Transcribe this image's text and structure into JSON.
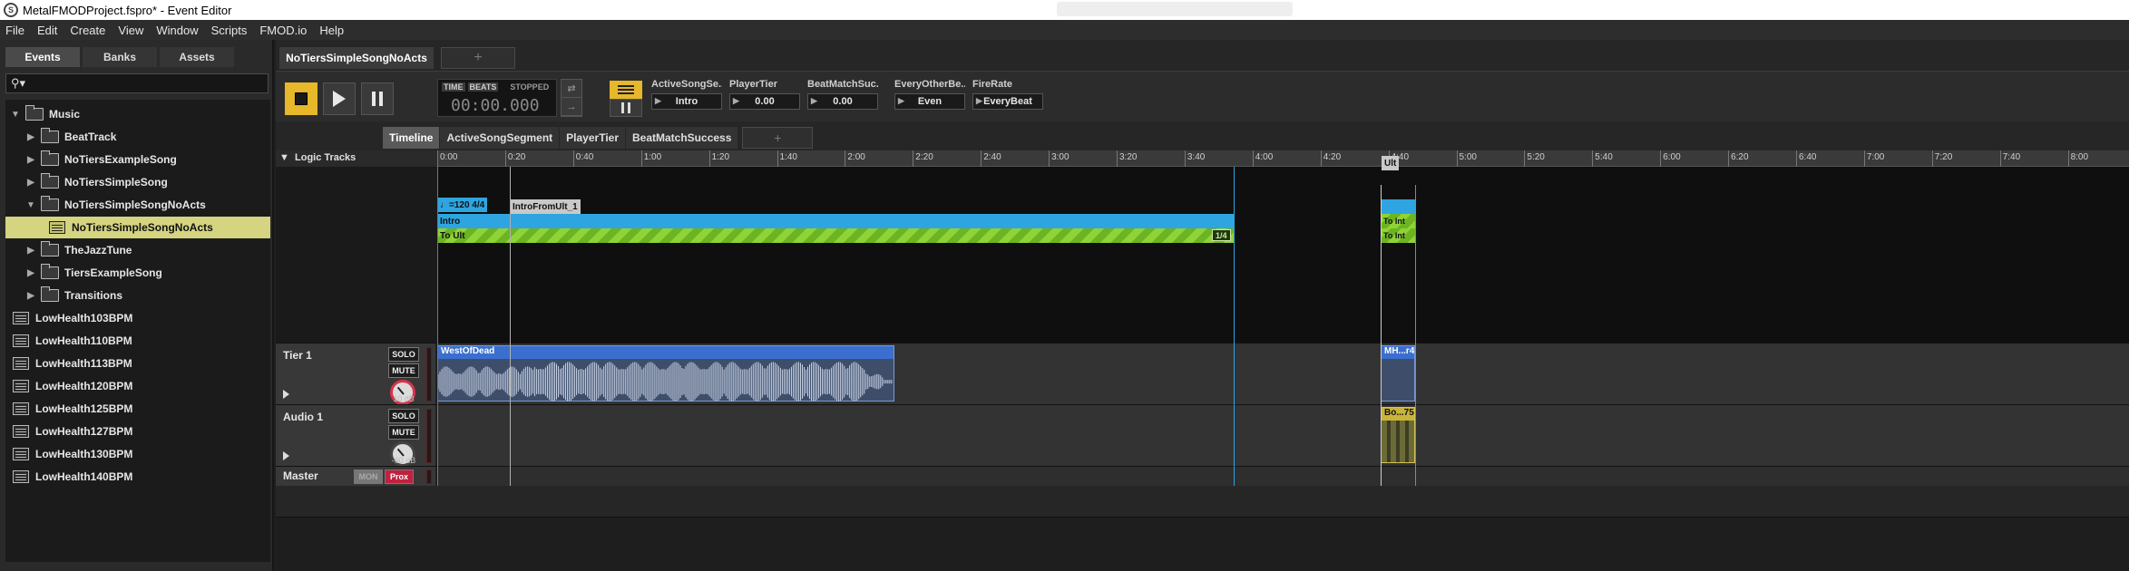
{
  "window": {
    "title": "MetalFMODProject.fspro* - Event Editor"
  },
  "menu": [
    "File",
    "Edit",
    "Create",
    "View",
    "Window",
    "Scripts",
    "FMOD.io",
    "Help"
  ],
  "browser": {
    "tabs": [
      "Events",
      "Banks",
      "Assets"
    ],
    "search_placeholder": "",
    "tree": [
      {
        "label": "Music",
        "type": "folder",
        "arrow": "▼",
        "level": 0
      },
      {
        "label": "BeatTrack",
        "type": "folder",
        "arrow": "▶",
        "level": 1
      },
      {
        "label": "NoTiersExampleSong",
        "type": "folder",
        "arrow": "▶",
        "level": 1
      },
      {
        "label": "NoTiersSimpleSong",
        "type": "folder",
        "arrow": "▶",
        "level": 1
      },
      {
        "label": "NoTiersSimpleSongNoActs",
        "type": "folder",
        "arrow": "▼",
        "level": 1
      },
      {
        "label": "NoTiersSimpleSongNoActs",
        "type": "event",
        "arrow": "",
        "level": 2,
        "selected": true
      },
      {
        "label": "TheJazzTune",
        "type": "folder",
        "arrow": "▶",
        "level": 1
      },
      {
        "label": "TiersExampleSong",
        "type": "folder",
        "arrow": "▶",
        "level": 1
      },
      {
        "label": "Transitions",
        "type": "folder",
        "arrow": "▶",
        "level": 1
      },
      {
        "label": "LowHealth103BPM",
        "type": "event",
        "arrow": "",
        "level": 0
      },
      {
        "label": "LowHealth110BPM",
        "type": "event",
        "arrow": "",
        "level": 0
      },
      {
        "label": "LowHealth113BPM",
        "type": "event",
        "arrow": "",
        "level": 0
      },
      {
        "label": "LowHealth120BPM",
        "type": "event",
        "arrow": "",
        "level": 0
      },
      {
        "label": "LowHealth125BPM",
        "type": "event",
        "arrow": "",
        "level": 0
      },
      {
        "label": "LowHealth127BPM",
        "type": "event",
        "arrow": "",
        "level": 0
      },
      {
        "label": "LowHealth130BPM",
        "type": "event",
        "arrow": "",
        "level": 0
      },
      {
        "label": "LowHealth140BPM",
        "type": "event",
        "arrow": "",
        "level": 0
      }
    ]
  },
  "editor": {
    "event_tab": "NoTiersSimpleSongNoActs",
    "add_tab": "+",
    "time": {
      "mode_time": "TIME",
      "mode_beats": "BEATS",
      "state": "STOPPED",
      "value": "00:00.000"
    },
    "parameters": [
      {
        "name": "ActiveSongSe...",
        "value": "Intro"
      },
      {
        "name": "PlayerTier",
        "value": "0.00"
      },
      {
        "name": "BeatMatchSuc...",
        "value": "0.00"
      },
      {
        "name": "EveryOtherBe...",
        "value": "Even"
      },
      {
        "name": "FireRate",
        "value": "EveryBeat"
      }
    ],
    "subtabs": [
      "Timeline",
      "ActiveSongSegment",
      "PlayerTier",
      "BeatMatchSuccess"
    ],
    "logic_tracks_label": "Logic Tracks",
    "ruler": [
      "0:00",
      "0:20",
      "0:40",
      "1:00",
      "1:20",
      "1:40",
      "2:00",
      "2:20",
      "2:40",
      "3:00",
      "3:20",
      "3:40",
      "4:00",
      "4:20",
      "4:40",
      "5:00",
      "5:20",
      "5:40",
      "6:00",
      "6:20",
      "6:40",
      "7:00",
      "7:20",
      "7:40",
      "8:00"
    ],
    "markers": {
      "tempo": "♩=120 4/4",
      "transition": "IntroFromUlt_1",
      "ult": "Ult",
      "intro_region": "Intro",
      "to_ult": "To Ult",
      "loop_badge": "1/4",
      "to_intro_1": "To Int",
      "to_intro_2": "To Int",
      "to_intro_badge": "1"
    },
    "tracks": [
      {
        "name": "Tier 1",
        "solo": "SOLO",
        "mute": "MUTE",
        "db": "10 dB",
        "clip": "WestOfDead",
        "clip2": "MH...r4"
      },
      {
        "name": "Audio 1",
        "solo": "SOLO",
        "mute": "MUTE",
        "db": "-60 dB",
        "clip2": "Bo...754"
      }
    ],
    "master": {
      "name": "Master",
      "mon": "MON",
      "prox": "Prox"
    }
  },
  "colors": {
    "accent": "#e6b82a",
    "intro": "#2ea5e0",
    "to_ult": "#8fd336",
    "selection": "#d4d481",
    "clip": "#3a6fcf"
  }
}
